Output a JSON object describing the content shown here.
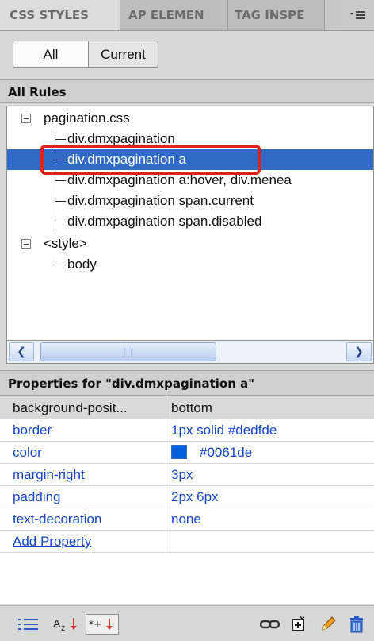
{
  "tabs": [
    {
      "label": "CSS STYLES"
    },
    {
      "label": "AP ELEMEN"
    },
    {
      "label": "TAG INSPE"
    }
  ],
  "toolbar_top": {
    "menu_icon": "panel-options-icon"
  },
  "mode_toggle": {
    "all_label": "All",
    "current_label": "Current",
    "selected": "All"
  },
  "rules_section": {
    "header": "All Rules",
    "tree": [
      {
        "label": "pagination.css",
        "kind": "sheet"
      },
      {
        "label": "div.dmxpagination",
        "kind": "rule"
      },
      {
        "label": "div.dmxpagination a",
        "kind": "rule",
        "selected": true
      },
      {
        "label": "div.dmxpagination a:hover, div.menea",
        "kind": "rule"
      },
      {
        "label": "div.dmxpagination span.current",
        "kind": "rule"
      },
      {
        "label": "div.dmxpagination span.disabled",
        "kind": "rule"
      },
      {
        "label": "<style>",
        "kind": "sheet"
      },
      {
        "label": "body",
        "kind": "rule"
      }
    ]
  },
  "properties_section": {
    "header": "Properties for \"div.dmxpagination a\"",
    "rows": [
      {
        "name": "background-posit...",
        "value": "bottom"
      },
      {
        "name": "border",
        "value": "1px solid #dedfde"
      },
      {
        "name": "color",
        "value": "#0061de",
        "swatch": "#0061de"
      },
      {
        "name": "margin-right",
        "value": "3px"
      },
      {
        "name": "padding",
        "value": "2px 6px"
      },
      {
        "name": "text-decoration",
        "value": "none"
      }
    ],
    "add_property": "Add Property"
  },
  "colors": {
    "selection": "#316ac5",
    "highlight_box": "#e0201f",
    "property_text": "#1746c9"
  }
}
